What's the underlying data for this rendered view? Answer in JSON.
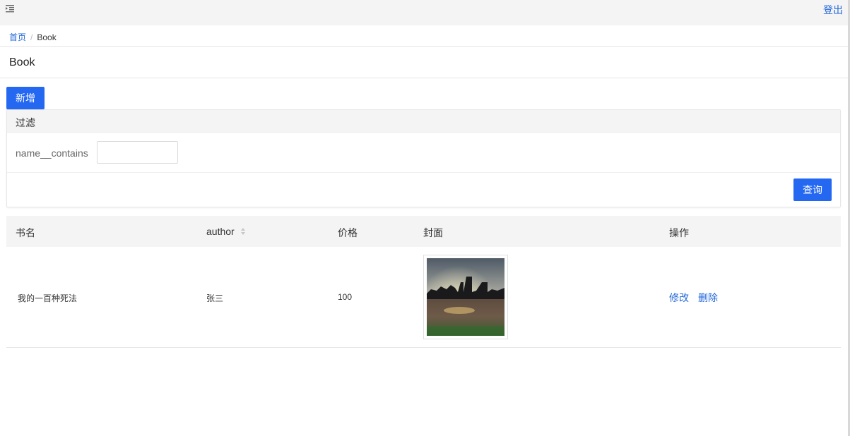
{
  "header": {
    "menu_icon": "menu-fold-icon",
    "logout_label": "登出"
  },
  "breadcrumb": {
    "home": "首页",
    "separator": "/",
    "current": "Book"
  },
  "page": {
    "title": "Book",
    "add_label": "新增"
  },
  "filter": {
    "title": "过滤",
    "field_label": "name__contains",
    "field_value": "",
    "query_label": "查询"
  },
  "table": {
    "columns": [
      "书名",
      "author",
      "价格",
      "封面",
      "操作"
    ],
    "sortable_column_icon": "sort-icon",
    "rows": [
      {
        "name": "我的一百种死法",
        "author": "张三",
        "price": "100",
        "cover": "city-sunset-photo",
        "actions": [
          "修改",
          "删除"
        ]
      }
    ]
  },
  "colors": {
    "primary": "#2468f2",
    "link": "#1f66d9",
    "header_bg": "#f4f4f5"
  }
}
